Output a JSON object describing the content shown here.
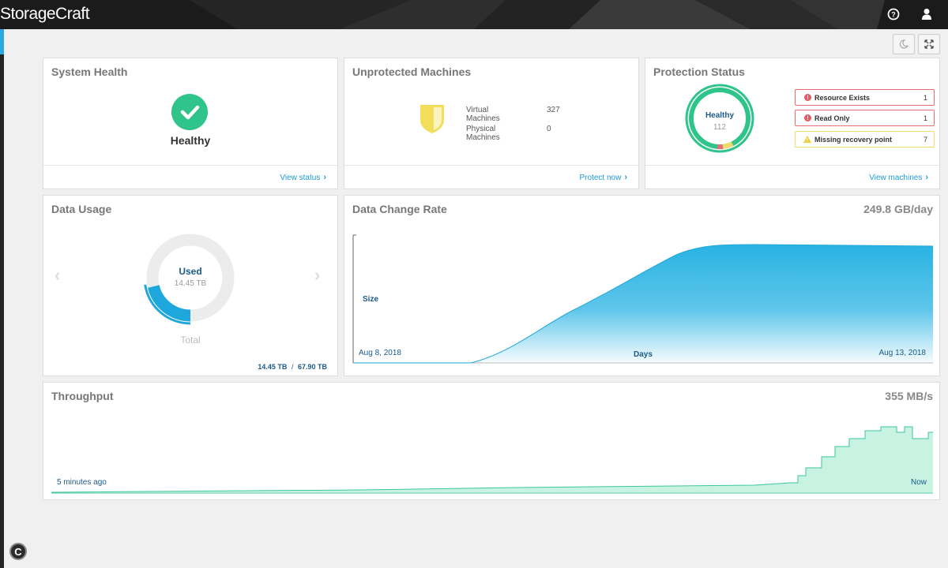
{
  "app": {
    "logo": "StorageCraft",
    "help_icon": "help-circle-icon",
    "user_icon": "user-icon",
    "copyright_symbol": "C"
  },
  "toolbar": {
    "night_mode_icon": "moon-icon",
    "fullscreen_icon": "expand-icon"
  },
  "system_health": {
    "title": "System Health",
    "status": "Healthy",
    "icon": "checkmark-circle-icon",
    "status_color": "#2fc48a",
    "link": "View status"
  },
  "unprotected": {
    "title": "Unprotected Machines",
    "shield_icon": "shield-icon",
    "shield_color": "#f2de5a",
    "rows": [
      {
        "label": "Virtual Machines",
        "value": "327"
      },
      {
        "label": "Physical Machines",
        "value": "0"
      }
    ],
    "link": "Protect now"
  },
  "protection": {
    "title": "Protection Status",
    "center_label": "Healthy",
    "center_value": "112",
    "ring_color": "#2fc48a",
    "alerts": [
      {
        "label": "Resource Exists",
        "count": "1",
        "severity": "error",
        "icon": "error-circle-icon"
      },
      {
        "label": "Read Only",
        "count": "1",
        "severity": "error",
        "icon": "error-circle-icon"
      },
      {
        "label": "Missing recovery point",
        "count": "7",
        "severity": "warning",
        "icon": "warning-triangle-icon"
      }
    ],
    "link": "View machines"
  },
  "data_usage": {
    "title": "Data Usage",
    "used_label": "Used",
    "used_value": "14.45 TB",
    "total_label": "Total",
    "footer_used": "14.45 TB",
    "footer_sep": "/",
    "footer_total": "67.90 TB",
    "used_fraction": 0.2128,
    "accent_color": "#1ea7dc"
  },
  "data_change": {
    "title": "Data Change Rate",
    "metric": "249.8 GB/day",
    "y_label": "Size",
    "x_label": "Days",
    "x_start": "Aug 8, 2018",
    "x_end": "Aug 13, 2018",
    "fill_color": "#29b3e3"
  },
  "throughput": {
    "title": "Throughput",
    "metric": "355 MB/s",
    "x_start": "5 minutes ago",
    "x_end": "Now",
    "fill_color": "#c8f3e2",
    "line_color": "#3cc79a"
  }
}
